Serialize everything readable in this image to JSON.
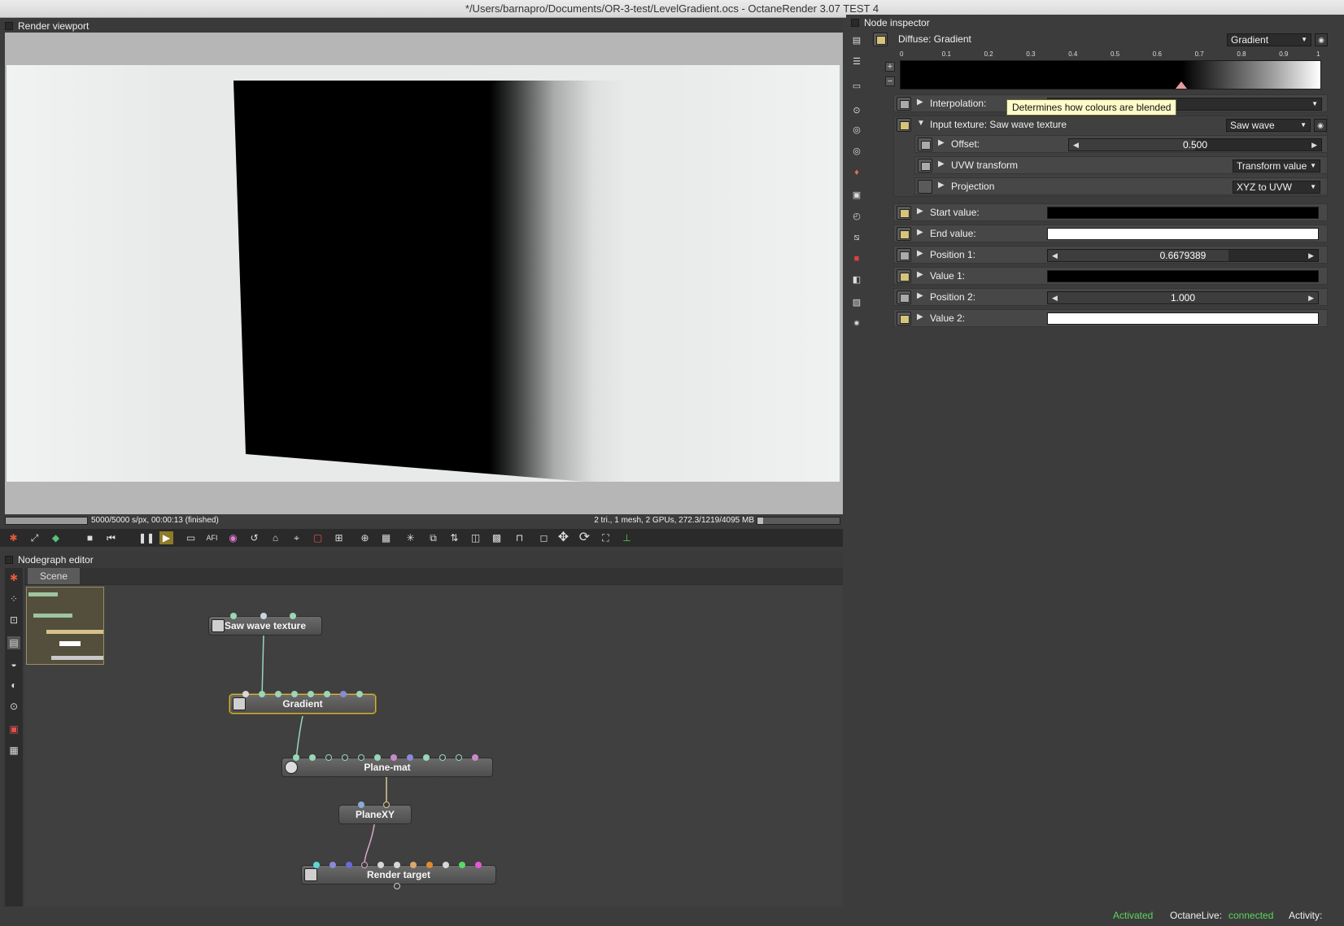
{
  "window": {
    "title": "*/Users/barnapro/Documents/OR-3-test/LevelGradient.ocs - OctaneRender 3.07 TEST 4"
  },
  "viewport": {
    "header": "Render viewport",
    "status_left": "5000/5000 s/px, 00:00:13 (finished)",
    "status_right": "2 tri., 1 mesh, 2 GPUs, 272.3/1219/4095 MB",
    "progress": 1.0,
    "memory_fraction": 0.07
  },
  "toolbar": {
    "icons": [
      "octane-logo-icon",
      "camera-reset-icon",
      "cube-color-icon",
      "stop-icon",
      "restart-icon",
      "pause-icon",
      "play-icon",
      "monitor-icon",
      "af-icon",
      "color-wheel-icon",
      "refresh-rgb-icon",
      "region-icon",
      "picker-icon",
      "crop-icon",
      "film-region-icon",
      "zoom-icon",
      "region-select-icon",
      "loading-icon",
      "copy-icon",
      "upload-icon",
      "layers-icon",
      "checker-icon",
      "lock-open-icon",
      "cube-icon",
      "move-icon",
      "rotate-icon",
      "fullscreen-icon",
      "axis-icon"
    ],
    "af_label": "AFI"
  },
  "nodegraph": {
    "header": "Nodegraph editor",
    "tab": "Scene",
    "nodes": {
      "saw": "Saw wave texture",
      "gradient": "Gradient",
      "plane_mat": "Plane-mat",
      "planexy": "PlaneXY",
      "render_target": "Render target"
    }
  },
  "inspector": {
    "header": "Node inspector",
    "title": "Diffuse: Gradient",
    "type_combo": "Gradient",
    "ruler_ticks": [
      "0",
      "0.1",
      "0.2",
      "0.3",
      "0.4",
      "0.5",
      "0.6",
      "0.7",
      "0.8",
      "0.9",
      "1"
    ],
    "gradient_marker": 0.668,
    "interpolation_label": "Interpolation:",
    "tooltip": "Determines how colours are blended",
    "input_texture_label": "Input texture: Saw wave texture",
    "input_texture_combo": "Saw wave",
    "offset_label": "Offset:",
    "offset_value": "0.500",
    "uvw_label": "UVW transform",
    "uvw_combo": "Transform value",
    "projection_label": "Projection",
    "projection_combo": "XYZ to UVW",
    "start_label": "Start value:",
    "start_color": "#000000",
    "end_label": "End value:",
    "end_color": "#ffffff",
    "pos1_label": "Position 1:",
    "pos1_value": "0.6679389",
    "pos1_fraction": 0.668,
    "value1_label": "Value 1:",
    "value1_color": "#000000",
    "pos2_label": "Position 2:",
    "pos2_value": "1.000",
    "pos2_fraction": 1.0,
    "value2_label": "Value 2:",
    "value2_color": "#ffffff"
  },
  "status_bar": {
    "activated": "Activated",
    "live_label": "OctaneLive:",
    "live_status": "connected",
    "activity_label": "Activity:"
  },
  "colors": {
    "accent_green": "#5bd75b",
    "selection_gold": "#d8b43a",
    "tooltip_bg": "#fffbc8"
  }
}
